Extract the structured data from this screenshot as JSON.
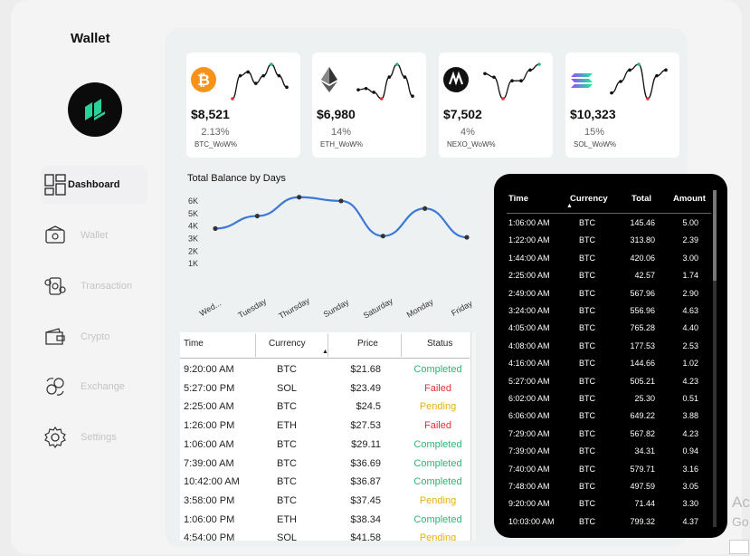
{
  "app": {
    "title": "Wallet"
  },
  "sidebar": {
    "items": [
      {
        "label": "Dashboard",
        "icon": "dashboard-icon",
        "active": true
      },
      {
        "label": "Wallet",
        "icon": "wallet-icon",
        "active": false
      },
      {
        "label": "Transaction",
        "icon": "transaction-icon",
        "active": false
      },
      {
        "label": "Crypto",
        "icon": "crypto-icon",
        "active": false
      },
      {
        "label": "Exchange",
        "icon": "exchange-icon",
        "active": false
      },
      {
        "label": "Settings",
        "icon": "gear-icon",
        "active": false
      }
    ]
  },
  "cards": [
    {
      "icon": "bitcoin-icon",
      "price": "$8,521",
      "change": "2.13%",
      "label": "BTC_WoW%",
      "spark": [
        3,
        6,
        6.5,
        5,
        6,
        7.5,
        6,
        4.5
      ]
    },
    {
      "icon": "ethereum-icon",
      "price": "$6,980",
      "change": "14%",
      "label": "ETH_WoW%",
      "spark": [
        5.5,
        5.6,
        5.3,
        4.8,
        6.5,
        7.5,
        6.5,
        5
      ]
    },
    {
      "icon": "nexo-icon",
      "price": "$7,502",
      "change": "4%",
      "label": "NEXO_WoW%",
      "spark": [
        6.5,
        6,
        3,
        5.5,
        5.5,
        7,
        7.8
      ]
    },
    {
      "icon": "solana-icon",
      "price": "$10,323",
      "change": "15%",
      "label": "SOL_WoW%",
      "spark": [
        4,
        5,
        6,
        6.5,
        3.5,
        5.5,
        6
      ]
    }
  ],
  "colors": {
    "accent_green": "#2bb673",
    "failed_red": "#e0312f",
    "pending_yellow": "#e6b117",
    "line_blue": "#3c78d8"
  },
  "chart_data": {
    "type": "line",
    "title": "Total Balance by Days",
    "categories": [
      "Wed...",
      "Tuesday",
      "Thursday",
      "Sunday",
      "Saturday",
      "Monday",
      "Friday"
    ],
    "values": [
      3800,
      4800,
      6300,
      6000,
      3200,
      5400,
      3100
    ],
    "y_ticks": [
      "6K",
      "5K",
      "4K",
      "3K",
      "2K",
      "1K"
    ],
    "ylim": [
      0,
      6500
    ],
    "grid": false
  },
  "transactions": {
    "columns": [
      "Time",
      "Currency",
      "Price",
      "Status"
    ],
    "rows": [
      [
        "9:20:00 AM",
        "BTC",
        "$21.68",
        "Completed"
      ],
      [
        "5:27:00 PM",
        "SOL",
        "$23.49",
        "Failed"
      ],
      [
        "2:25:00 AM",
        "BTC",
        "$24.5",
        "Pending"
      ],
      [
        "1:26:00 PM",
        "ETH",
        "$27.53",
        "Failed"
      ],
      [
        "1:06:00 AM",
        "BTC",
        "$29.11",
        "Completed"
      ],
      [
        "7:39:00 AM",
        "BTC",
        "$36.69",
        "Completed"
      ],
      [
        "10:42:00 AM",
        "BTC",
        "$36.87",
        "Completed"
      ],
      [
        "3:58:00 PM",
        "BTC",
        "$37.45",
        "Pending"
      ],
      [
        "1:06:00 PM",
        "ETH",
        "$38.34",
        "Completed"
      ],
      [
        "4:54:00 PM",
        "SOL",
        "$41.58",
        "Pending"
      ]
    ]
  },
  "amounts": {
    "columns": [
      "Time",
      "Currency",
      "Total",
      "Amount"
    ],
    "rows": [
      [
        "1:06:00 AM",
        "BTC",
        "145.46",
        "5.00"
      ],
      [
        "1:22:00 AM",
        "BTC",
        "313.80",
        "2.39"
      ],
      [
        "1:44:00 AM",
        "BTC",
        "420.06",
        "3.00"
      ],
      [
        "2:25:00 AM",
        "BTC",
        "42.57",
        "1.74"
      ],
      [
        "2:49:00 AM",
        "BTC",
        "567.96",
        "2.90"
      ],
      [
        "3:24:00 AM",
        "BTC",
        "556.96",
        "4.63"
      ],
      [
        "4:05:00 AM",
        "BTC",
        "765.28",
        "4.40"
      ],
      [
        "4:08:00 AM",
        "BTC",
        "177.53",
        "2.53"
      ],
      [
        "4:16:00 AM",
        "BTC",
        "144.66",
        "1.02"
      ],
      [
        "5:27:00 AM",
        "BTC",
        "505.21",
        "4.23"
      ],
      [
        "6:02:00 AM",
        "BTC",
        "25.30",
        "0.51"
      ],
      [
        "6:06:00 AM",
        "BTC",
        "649.22",
        "3.88"
      ],
      [
        "7:29:00 AM",
        "BTC",
        "567.82",
        "4.23"
      ],
      [
        "7:39:00 AM",
        "BTC",
        "34.31",
        "0.94"
      ],
      [
        "7:40:00 AM",
        "BTC",
        "579.71",
        "3.16"
      ],
      [
        "7:48:00 AM",
        "BTC",
        "497.59",
        "3.05"
      ],
      [
        "9:20:00 AM",
        "BTC",
        "71.44",
        "3.30"
      ],
      [
        "10:03:00 AM",
        "BTC",
        "799.32",
        "4.37"
      ]
    ]
  },
  "watermark": {
    "line1": "Ac",
    "line2": "Go"
  }
}
